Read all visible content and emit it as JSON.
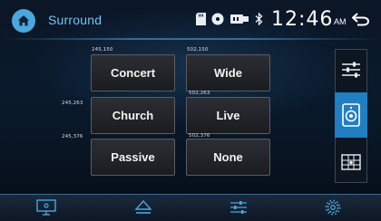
{
  "header": {
    "title": "Surround",
    "time": "12:46",
    "ampm": "AM"
  },
  "status_icons": [
    "sd-card-icon",
    "disc-icon",
    "usb-icon",
    "bluetooth-icon"
  ],
  "presets": [
    {
      "label": "Concert",
      "coord": "245,150"
    },
    {
      "label": "Wide",
      "coord": "502,150"
    },
    {
      "label": "Church",
      "coord": "245,263"
    },
    {
      "label": "Live",
      "coord": "502,263"
    },
    {
      "label": "Passive",
      "coord": "245,376"
    },
    {
      "label": "None",
      "coord": "502,376"
    }
  ],
  "side_menu": [
    {
      "icon": "equalizer-sliders-icon",
      "active": false
    },
    {
      "icon": "speaker-icon",
      "active": true
    },
    {
      "icon": "balance-grid-icon",
      "active": false
    }
  ],
  "bottom_bar": [
    "screen-icon",
    "eject-icon",
    "audio-settings-icon",
    "settings-gear-icon"
  ],
  "colors": {
    "accent": "#4aa8dc",
    "title": "#6fc6f2",
    "active_tab": "#1f7fc2"
  }
}
